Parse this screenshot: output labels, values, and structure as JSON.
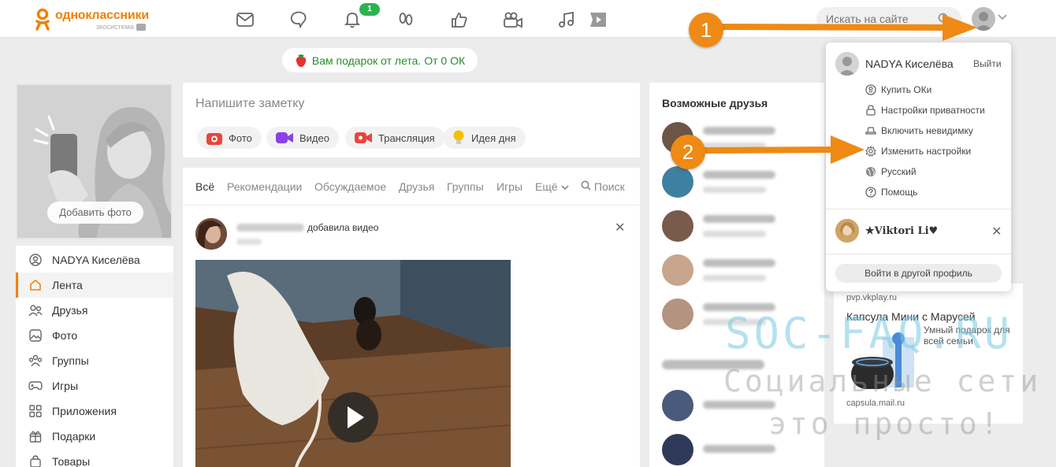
{
  "header": {
    "logo_name": "одноклассники",
    "logo_sub": "экосистема",
    "notification_count": "1",
    "search_placeholder": "Искать на сайте",
    "nav_icons": [
      "messages-icon",
      "discussions-icon",
      "notifications-icon",
      "guests-icon",
      "events-icon",
      "video-icon",
      "music-icon",
      "vk-play-icon"
    ]
  },
  "gift_banner": "Вам подарок от лета. От 0 ОК",
  "profile": {
    "add_photo": "Добавить фото"
  },
  "left_menu": {
    "items": [
      {
        "label": "NADYA Киселёва",
        "icon": "user-icon"
      },
      {
        "label": "Лента",
        "icon": "home-icon"
      },
      {
        "label": "Друзья",
        "icon": "friends-icon"
      },
      {
        "label": "Фото",
        "icon": "photo-icon"
      },
      {
        "label": "Группы",
        "icon": "groups-icon"
      },
      {
        "label": "Игры",
        "icon": "gamepad-icon"
      },
      {
        "label": "Приложения",
        "icon": "apps-icon"
      },
      {
        "label": "Подарки",
        "icon": "gift-icon"
      },
      {
        "label": "Товары",
        "icon": "bag-icon"
      }
    ],
    "active_index": 1
  },
  "note": {
    "placeholder": "Напишите заметку",
    "buttons": [
      {
        "label": "Фото",
        "icon": "camera-icon",
        "color": "#e8453c"
      },
      {
        "label": "Видео",
        "icon": "video-camera-icon",
        "color": "#8a42e8"
      },
      {
        "label": "Трансляция",
        "icon": "broadcast-icon",
        "color": "#e8453c"
      },
      {
        "label": "Идея дня",
        "icon": "lightbulb-icon",
        "color": "#f5b800"
      }
    ]
  },
  "feed": {
    "tabs": [
      "Всё",
      "Рекомендации",
      "Обсуждаемое",
      "Друзья",
      "Группы",
      "Игры",
      "Ещё",
      "Поиск"
    ],
    "active_tab": 0,
    "post": {
      "action": "добавила видео"
    }
  },
  "friends": {
    "title": "Возможные друзья"
  },
  "ad": {
    "host": "pvp.vkplay.ru",
    "title": "Капсула Мини с Марусей",
    "desc": "Умный подарок для всей семьи",
    "foot": "capsula.mail.ru"
  },
  "dropdown": {
    "name": "NADYA Киселёва",
    "logout": "Выйти",
    "items": [
      {
        "label": "Купить ОКи",
        "icon": "ok-coin-icon"
      },
      {
        "label": "Настройки приватности",
        "icon": "lock-icon"
      },
      {
        "label": "Включить невидимку",
        "icon": "invisible-icon"
      },
      {
        "label": "Изменить настройки",
        "icon": "gear-icon"
      },
      {
        "label": "Русский",
        "icon": "globe-icon"
      },
      {
        "label": "Помощь",
        "icon": "help-icon"
      }
    ],
    "other_account": "★Viktori Li♥",
    "login_other": "Войти в другой профиль"
  },
  "annotations": {
    "step1": "1",
    "step2": "2",
    "arrow_color": "#ee8a15"
  },
  "watermark": {
    "line1": "SOC-FAQ.RU",
    "line2": "Социальные сети",
    "line3": "это просто!"
  }
}
